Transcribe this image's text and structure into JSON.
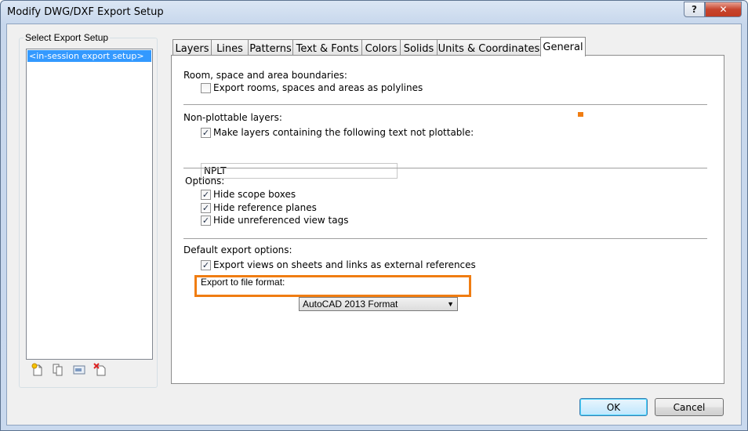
{
  "window": {
    "title": "Modify DWG/DXF Export Setup",
    "help_label": "?",
    "close_label": "✕"
  },
  "left": {
    "group_label": "Select Export Setup",
    "items": [
      "<in-session export setup>"
    ],
    "toolbar_icons": [
      "new-setup-icon",
      "duplicate-setup-icon",
      "rename-setup-icon",
      "delete-setup-icon"
    ]
  },
  "tabs": [
    "Layers",
    "Lines",
    "Patterns",
    "Text & Fonts",
    "Colors",
    "Solids",
    "Units & Coordinates",
    "General"
  ],
  "active_tab": "General",
  "general": {
    "room_section": "Room, space and area boundaries:",
    "room_checkbox": {
      "label": "Export rooms, spaces and areas as polylines",
      "checked": false
    },
    "nonplot_section": "Non-plottable layers:",
    "nonplot_checkbox": {
      "label": "Make layers containing the following text not plottable:",
      "checked": true
    },
    "nonplot_text": "NPLT",
    "options_section": "Options:",
    "options": [
      {
        "label": "Hide scope boxes",
        "checked": true
      },
      {
        "label": "Hide reference planes",
        "checked": true
      },
      {
        "label": "Hide unreferenced view tags",
        "checked": true
      }
    ],
    "default_section": "Default export options:",
    "xref_checkbox": {
      "label": "Export views on sheets and links as external references",
      "checked": true
    },
    "format_label": "Export to file format:",
    "format_value": "AutoCAD 2013 Format",
    "check_glyph": "✓",
    "dropdown_glyph": "▼"
  },
  "buttons": {
    "ok": "OK",
    "cancel": "Cancel"
  },
  "colors": {
    "highlight": "#f07d12",
    "selection": "#3399ff"
  }
}
